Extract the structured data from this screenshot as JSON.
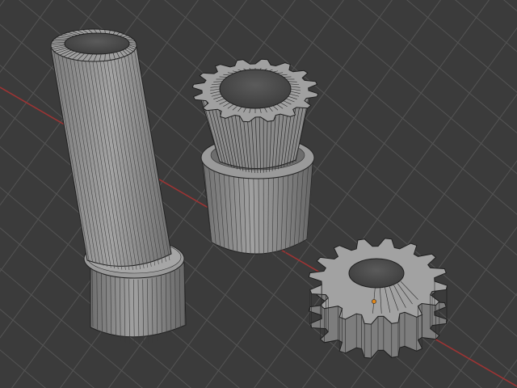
{
  "viewport": {
    "background": "#3b3b3b",
    "grid_color": "#545454",
    "x_axis_color": "#9c3434",
    "mesh_fill": "#8c8c8c",
    "mesh_wire": "#1e1e1e",
    "origin_color": "#e0871a"
  },
  "objects": [
    {
      "name": "tall-tube"
    },
    {
      "name": "pinion-gear-assembly"
    },
    {
      "name": "spur-gear"
    }
  ]
}
